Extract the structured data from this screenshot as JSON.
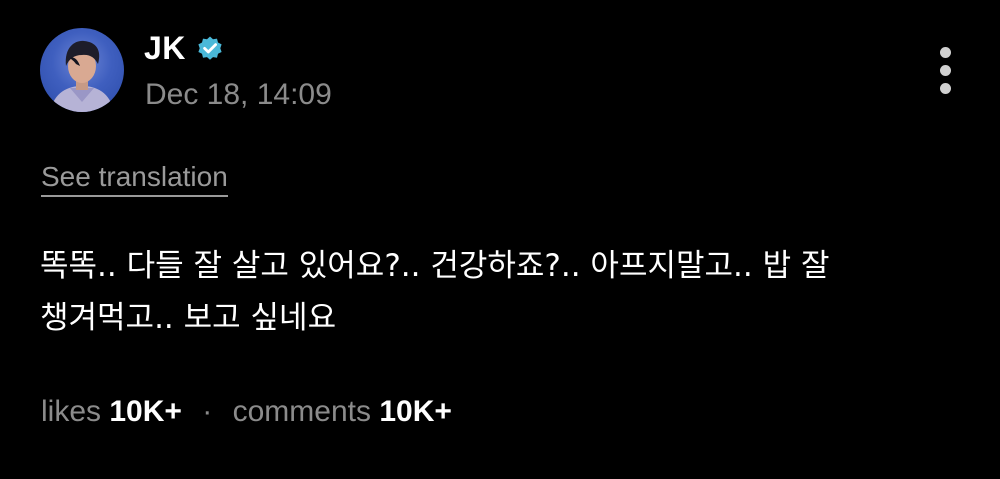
{
  "post": {
    "author": {
      "name": "JK",
      "verified": true
    },
    "timestamp": "Dec 18, 14:09",
    "see_translation_label": "See translation",
    "text": "똑똑.. 다들 잘 살고 있어요?.. 건강하죠?.. 아프지말고.. 밥 잘\n챙겨먹고.. 보고 싶네요",
    "stats": {
      "likes_label": "likes",
      "likes_value": "10K+",
      "separator": "·",
      "comments_label": "comments",
      "comments_value": "10K+"
    }
  },
  "icons": {
    "verified": "verified-badge-icon",
    "more": "more-vertical-icon"
  },
  "colors": {
    "background": "#000000",
    "primary_text": "#ffffff",
    "secondary_text": "#8b8b8b",
    "verified_badge": "#4ab8d8"
  }
}
